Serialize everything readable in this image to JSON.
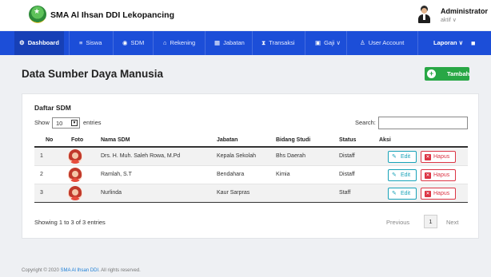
{
  "header": {
    "app_title": "SMA Al Ihsan DDI Lekopancing",
    "user_name": "Administrator",
    "user_status": "aktif ∨"
  },
  "nav": {
    "items": [
      {
        "label": "Dashboard",
        "icon": "⚙",
        "icon_name": "dashboard-icon"
      },
      {
        "label": "Siswa",
        "icon": "≡",
        "icon_name": "students-icon"
      },
      {
        "label": "SDM",
        "icon": "◉",
        "icon_name": "staff-icon"
      },
      {
        "label": "Rekening",
        "icon": "⌂",
        "icon_name": "bank-icon"
      },
      {
        "label": "Jabatan",
        "icon": "▦",
        "icon_name": "position-icon"
      },
      {
        "label": "Transaksi",
        "icon": "⧗",
        "icon_name": "transaction-icon"
      },
      {
        "label": "Gaji ∨",
        "icon": "▣",
        "icon_name": "salary-icon"
      },
      {
        "label": "User Account",
        "icon": "♙",
        "icon_name": "user-account-icon"
      },
      {
        "label": "Laporan ∨",
        "icon": "",
        "icon_name": ""
      }
    ],
    "trash_icon": "■"
  },
  "page": {
    "title": "Data Sumber Daya Manusia",
    "add_button": "Tambah"
  },
  "table": {
    "card_title": "Daftar SDM",
    "show_label": "Show",
    "show_value": "10",
    "entries_label": "entries",
    "search_label": "Search:",
    "search_value": "",
    "columns": [
      "No",
      "Foto",
      "Nama SDM",
      "Jabatan",
      "Bidang Studi",
      "Status",
      "Aksi"
    ],
    "rows": [
      {
        "no": "1",
        "nama": "Drs. H. Muh. Saleh Rowa, M.Pd",
        "jabatan": "Kepala Sekolah",
        "bidang": "Bhs Daerah",
        "status": "Distaff"
      },
      {
        "no": "2",
        "nama": "Ramlah, S.T",
        "jabatan": "Bendahara",
        "bidang": "Kimia",
        "status": "Distaff"
      },
      {
        "no": "3",
        "nama": "Nurlinda",
        "jabatan": "Kaur Sarpras",
        "bidang": "",
        "status": "Staff"
      }
    ],
    "edit_label": "Edit",
    "hapus_label": "Hapus",
    "info": "Showing 1 to 3 of 3 entries",
    "prev_label": "Previous",
    "page_number": "1",
    "next_label": "Next"
  },
  "footer": {
    "copyright_prefix": "Copyright © 2020 ",
    "copyright_link": "SMA Al Ihsan DDI",
    "copyright_suffix": ". All rights reserved."
  },
  "colors": {
    "nav_bg": "#1c4ed8",
    "add_button": "#28a745",
    "edit_button": "#17a2b8",
    "delete_button": "#dc3545"
  }
}
